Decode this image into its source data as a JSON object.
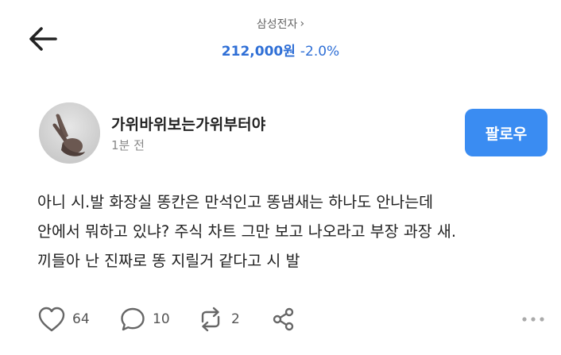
{
  "header": {
    "stock_name": "삼성전자",
    "stock_chevron": "›",
    "price": "212,000원",
    "change": "-2.0%",
    "accent_color": "#2f6fd6",
    "back_icon": "arrow-left-icon"
  },
  "author": {
    "name": "가위바위보는가위부터야",
    "time": "1분 전",
    "avatar_icon": "victory-hand-avatar"
  },
  "follow": {
    "label": "팔로우",
    "color": "#3a8cf2"
  },
  "post": {
    "lines": [
      "아니 시.발 화장실 똥칸은 만석인고 똥냄새는 하나도 안나는데",
      "안에서 뭐하고 있냐? 주식 차트 그만 보고 나오라고 부장 과장 새.",
      "끼들아 난 진짜로 똥 지릴거 같다고 시 발"
    ]
  },
  "actions": {
    "likes": "64",
    "comments": "10",
    "reposts": "2",
    "like_icon": "heart-icon",
    "comment_icon": "comment-bubble-icon",
    "repost_icon": "repost-icon",
    "share_icon": "share-icon",
    "more_icon": "more-dots-icon"
  }
}
